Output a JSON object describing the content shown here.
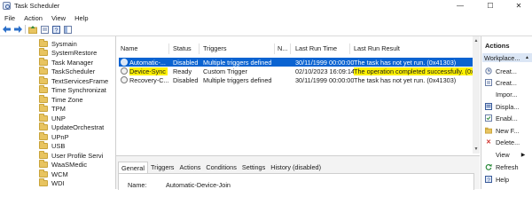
{
  "window": {
    "title": "Task Scheduler",
    "controls": {
      "minimize": "—",
      "maximize": "☐",
      "close": "✕"
    }
  },
  "menu": [
    "File",
    "Action",
    "View",
    "Help"
  ],
  "tree": {
    "items": [
      "Sysmain",
      "SystemRestore",
      "Task Manager",
      "TaskScheduler",
      "TextServicesFrame",
      "Time Synchronizat",
      "Time Zone",
      "TPM",
      "UNP",
      "UpdateOrchestrat",
      "UPnP",
      "USB",
      "User Profile Servi",
      "WaaSMedic",
      "WCM",
      "WDI"
    ]
  },
  "tasks": {
    "columns": {
      "name": "Name",
      "status": "Status",
      "triggers": "Triggers",
      "next": "N...",
      "last_run_time": "Last Run Time",
      "last_run_result": "Last Run Result"
    },
    "rows": [
      {
        "name": "Automatic-...",
        "status": "Disabled",
        "triggers": "Multiple triggers defined",
        "last_run_time": "30/11/1999 00:00:00",
        "last_run_result": "The task has not yet run. (0x41303)"
      },
      {
        "name": "Device-Sync",
        "status": "Ready",
        "triggers": "Custom Trigger",
        "last_run_time": "02/10/2023 16:09:14",
        "last_run_result": "The operation completed successfully. (0x0)"
      },
      {
        "name": "Recovery-C...",
        "status": "Disabled",
        "triggers": "Multiple triggers defined",
        "last_run_time": "30/11/1999 00:00:00",
        "last_run_result": "The task has not yet run. (0x41303)"
      }
    ]
  },
  "details": {
    "tabs": [
      "General",
      "Triggers",
      "Actions",
      "Conditions",
      "Settings",
      "History (disabled)"
    ],
    "name_label": "Name:",
    "name_value": "Automatic-Device-Join"
  },
  "actions_pane": {
    "title": "Actions",
    "section": "Workplace...",
    "items": [
      {
        "label": "Creat...",
        "icon": "create-basic-task-icon"
      },
      {
        "label": "Creat...",
        "icon": "create-task-icon"
      },
      {
        "label": "Impor...",
        "icon": "import-icon"
      },
      {
        "label": "Displa...",
        "icon": "display-running-icon"
      },
      {
        "label": "Enabl...",
        "icon": "enable-history-icon"
      },
      {
        "label": "New F...",
        "icon": "new-folder-icon"
      },
      {
        "label": "Delete...",
        "icon": "delete-icon"
      },
      {
        "label": "View",
        "icon": "view-icon"
      },
      {
        "label": "Refresh",
        "icon": "refresh-icon"
      },
      {
        "label": "Help",
        "icon": "help-icon"
      }
    ]
  },
  "colors": {
    "selection": "#0a63d1",
    "highlight": "#fff200",
    "actions_header": "#dbe6f5"
  }
}
